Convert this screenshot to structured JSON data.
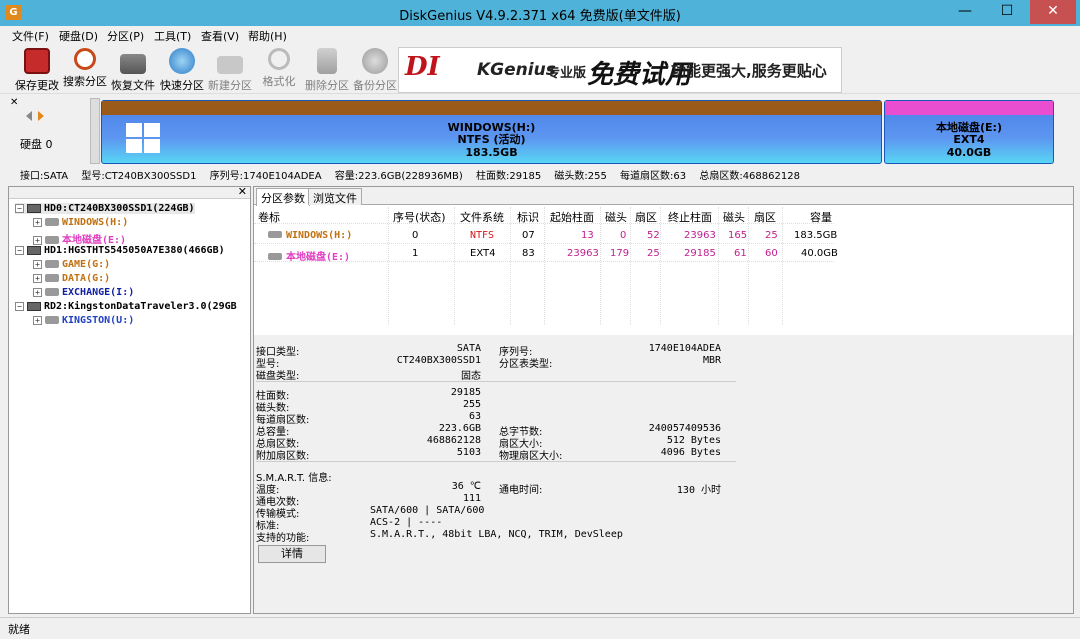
{
  "window": {
    "title": "DiskGenius V4.9.2.371 x64 免费版(单文件版)",
    "icon": "app-icon-g",
    "minimize": "—",
    "maximize": "☐",
    "close": "✕"
  },
  "menu": [
    "文件(F)",
    "硬盘(D)",
    "分区(P)",
    "工具(T)",
    "查看(V)",
    "帮助(H)"
  ],
  "toolbar": [
    {
      "label": "保存更改",
      "icon": "save-icon",
      "enabled": true
    },
    {
      "label": "搜索分区",
      "icon": "search-icon",
      "enabled": true
    },
    {
      "label": "恢复文件",
      "icon": "restore-icon",
      "enabled": true
    },
    {
      "label": "快速分区",
      "icon": "quick-partition-icon",
      "enabled": true
    },
    {
      "label": "新建分区",
      "icon": "new-partition-icon",
      "enabled": false
    },
    {
      "label": "格式化",
      "icon": "format-icon",
      "enabled": false
    },
    {
      "label": "删除分区",
      "icon": "delete-icon",
      "enabled": false
    },
    {
      "label": "备份分区",
      "icon": "backup-icon",
      "enabled": false
    }
  ],
  "banner": {
    "brand1": "DI",
    "brand2": "KGenius",
    "edition": "专业版",
    "slogan1": "免费试用",
    "slogan2": "功能更强大,服务更贴心"
  },
  "diskmap": {
    "disk_label": "硬盘 0",
    "partitions": [
      {
        "name": "WINDOWS(H:)",
        "fs": "NTFS (活动)",
        "size": "183.5GB",
        "cap_color": "#9a5a1a"
      },
      {
        "name": "本地磁盘(E:)",
        "fs": "EXT4",
        "size": "40.0GB",
        "cap_color": "#e84ecf"
      }
    ]
  },
  "infobar": {
    "iface": "接口:SATA",
    "model": "型号:CT240BX300SSD1",
    "serial": "序列号:1740E104ADEA",
    "capacity": "容量:223.6GB(228936MB)",
    "cyl": "柱面数:29185",
    "heads": "磁头数:255",
    "sectors": "每道扇区数:63",
    "total": "总扇区数:468862128"
  },
  "tree": {
    "close": "✕",
    "nodes": [
      {
        "label": "HD0:CT240BX300SSD1(224GB)",
        "kind": "disk",
        "color": "#000000",
        "selected": true
      },
      {
        "label": "WINDOWS(H:)",
        "kind": "part",
        "color": "#c07010"
      },
      {
        "label": "本地磁盘(E:)",
        "kind": "part",
        "color": "#e040c0"
      },
      {
        "label": "HD1:HGSTHTS545050A7E380(466GB)",
        "kind": "disk",
        "color": "#000000"
      },
      {
        "label": "GAME(G:)",
        "kind": "part",
        "color": "#c07010"
      },
      {
        "label": "DATA(G:)",
        "kind": "part",
        "color": "#c07010"
      },
      {
        "label": "EXCHANGE(I:)",
        "kind": "part",
        "color": "#1020a0"
      },
      {
        "label": "RD2:KingstonDataTraveler3.0(29GB",
        "kind": "disk",
        "color": "#000000"
      },
      {
        "label": "KINGSTON(U:)",
        "kind": "part",
        "color": "#2040c0"
      }
    ]
  },
  "tabs": [
    "分区参数",
    "浏览文件"
  ],
  "ptable": {
    "headers": [
      "卷标",
      "序号(状态)",
      "文件系统",
      "标识",
      "起始柱面",
      "磁头",
      "扇区",
      "终止柱面",
      "磁头",
      "扇区",
      "容量"
    ],
    "rows": [
      {
        "label": "WINDOWS(H:)",
        "color": "#c07010",
        "cells": [
          "0",
          "NTFS",
          "07",
          "13",
          "0",
          "52",
          "23963",
          "165",
          "25",
          "183.5GB"
        ]
      },
      {
        "label": "本地磁盘(E:)",
        "color": "#e040c0",
        "cells": [
          "1",
          "EXT4",
          "83",
          "23963",
          "179",
          "25",
          "29185",
          "61",
          "60",
          "40.0GB"
        ]
      }
    ]
  },
  "details": {
    "iface_l": "接口类型:",
    "iface_v": "SATA",
    "serial_l": "序列号:",
    "serial_v": "1740E104ADEA",
    "model_l": "型号:",
    "model_v": "CT240BX300SSD1",
    "ptt_l": "分区表类型:",
    "ptt_v": "MBR",
    "dtype_l": "磁盘类型:",
    "dtype_v": "固态",
    "cyl_l": "柱面数:",
    "cyl_v": "29185",
    "heads_l": "磁头数:",
    "heads_v": "255",
    "spt_l": "每道扇区数:",
    "spt_v": "63",
    "cap_l": "总容量:",
    "cap_v": "223.6GB",
    "bytes_l": "总字节数:",
    "bytes_v": "240057409536",
    "tsec_l": "总扇区数:",
    "tsec_v": "468862128",
    "secsize_l": "扇区大小:",
    "secsize_v": "512 Bytes",
    "extra_l": "附加扇区数:",
    "extra_v": "5103",
    "psec_l": "物理扇区大小:",
    "psec_v": "4096 Bytes",
    "smart_l": "S.M.A.R.T. 信息:",
    "temp_l": "温度:",
    "temp_v": "36 ℃",
    "hours_l": "通电时间:",
    "hours_v": "130 小时",
    "count_l": "通电次数:",
    "count_v": "111",
    "mode_l": "传输模式:",
    "mode_v": "SATA/600 | SATA/600",
    "std_l": "标准:",
    "std_v": "ACS-2 | ----",
    "feat_l": "支持的功能:",
    "feat_v": "S.M.A.R.T., 48bit LBA, NCQ, TRIM, DevSleep",
    "button": "详情"
  },
  "status": "就绪"
}
